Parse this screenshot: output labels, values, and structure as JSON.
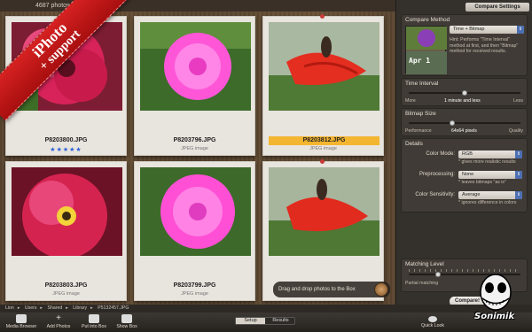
{
  "gallery": {
    "count": "4687 photos",
    "cards": [
      {
        "name": "P8203800.JPG",
        "type": "",
        "stars": "★★★★★",
        "selected": false
      },
      {
        "name": "P8203796.JPG",
        "type": "JPEG image",
        "stars": "",
        "selected": false
      },
      {
        "name": "P8203812.JPG",
        "type": "JPEG image",
        "stars": "",
        "selected": true
      },
      {
        "name": "P8203803.JPG",
        "type": "JPEG image",
        "stars": "",
        "selected": false
      },
      {
        "name": "P8203799.JPG",
        "type": "JPEG image",
        "stars": "",
        "selected": false
      },
      {
        "name": "",
        "type": "",
        "stars": "",
        "selected": false
      }
    ],
    "drag_hint": "Drag and drop photos to the Box"
  },
  "ribbon": {
    "line1": "iPhoto",
    "line2": "+ support"
  },
  "panel": {
    "tab": "Compare Settings",
    "compare_method": {
      "title": "Compare Method",
      "value": "Time + Bitmap",
      "hint": "Hint: Performs \"Time Interval\" method at first, and then \"Bitmap\" method for received results.",
      "thumb_text": "Apr 1"
    },
    "time_interval": {
      "title": "Time Interval",
      "left": "More",
      "center": "1 minute and less",
      "right": "Less",
      "level": 0.55
    },
    "bitmap_size": {
      "title": "Bitmap Size",
      "left": "Performance",
      "center": "64x64 pixels",
      "right": "Quality",
      "level": 0.4
    },
    "details": {
      "title": "Details",
      "color_mode_label": "Color Mode:",
      "color_mode_value": "RGB",
      "color_mode_hint": "* gives more realistic results",
      "preprocessing_label": "Preprocessing:",
      "preprocessing_value": "None",
      "preprocessing_hint": "* leaves bitmaps \"as is\"",
      "sensitivity_label": "Color Sensitivity:",
      "sensitivity_value": "Average",
      "sensitivity_hint": "* ignores difference in colors"
    },
    "matching_level": {
      "title": "Matching Level",
      "hint": "Partial matching",
      "level": 0.25
    },
    "compare_button": "Compare!"
  },
  "path": [
    "Lion",
    "Users",
    "Shared",
    "Library",
    "P5132457.JPG"
  ],
  "toolbar": {
    "media_browser": "Media Browser",
    "add_photos": "Add Photos",
    "put_into_box": "Put into Box",
    "show_box": "Show Box",
    "setup": "Setup",
    "results": "Results",
    "quick_look": "Quick Look"
  },
  "brand": "Sonimik",
  "colors": {
    "accent": "#f4b530",
    "ribbon": "#c41818",
    "stars": "#2a5fd8"
  }
}
